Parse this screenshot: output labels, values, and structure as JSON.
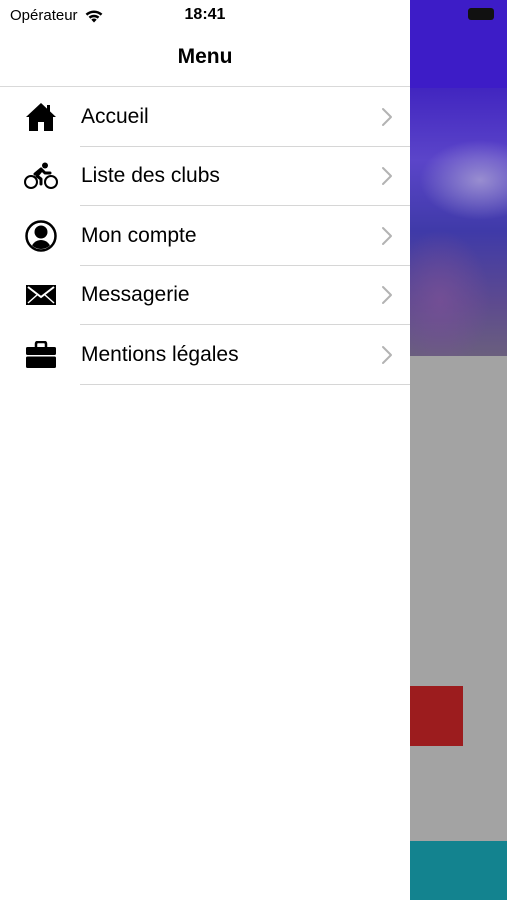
{
  "status_bar": {
    "carrier": "Opérateur",
    "time": "18:41"
  },
  "nav": {
    "title": "Menu"
  },
  "menu": {
    "items": [
      {
        "label": "Accueil",
        "icon": "home-icon"
      },
      {
        "label": "Liste des clubs",
        "icon": "bicycle-rider-icon"
      },
      {
        "label": "Mon compte",
        "icon": "user-circle-icon"
      },
      {
        "label": "Messagerie",
        "icon": "envelope-icon"
      },
      {
        "label": "Mentions légales",
        "icon": "briefcase-icon"
      }
    ]
  },
  "colors": {
    "background_hero": "#3d1cc7",
    "background_gray": "#a3a3a3",
    "background_red": "#9c1c1e",
    "background_teal": "#13838f",
    "separator": "#d6d6d6",
    "chevron": "#b3b3b3"
  }
}
